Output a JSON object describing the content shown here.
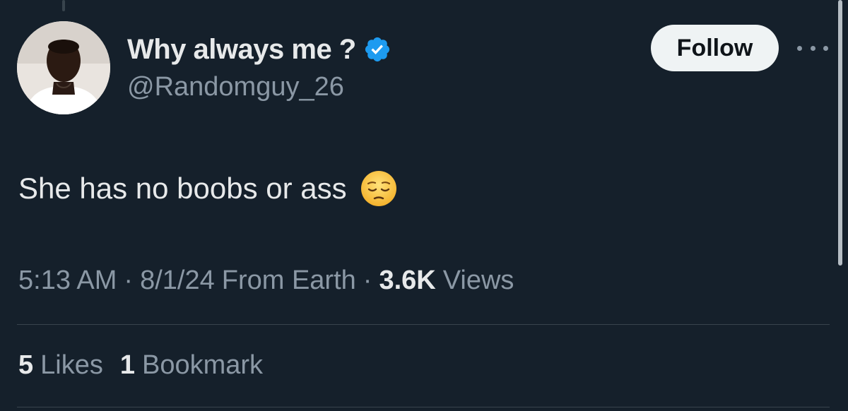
{
  "tweet": {
    "author": {
      "display_name": "Why always me ?",
      "handle": "@Randomguy_26",
      "verified": true,
      "avatar_icon": "profile-photo"
    },
    "follow_label": "Follow",
    "more_icon": "more-horizontal-icon",
    "text": "She has no boobs or ass",
    "emoji_icon": "pensive-face-emoji",
    "meta": {
      "time": "5:13 AM",
      "date": "8/1/24",
      "source": "From Earth",
      "views_count": "3.6K",
      "views_label": "Views"
    },
    "stats": {
      "likes_count": "5",
      "likes_label": "Likes",
      "bookmarks_count": "1",
      "bookmarks_label": "Bookmark"
    }
  },
  "colors": {
    "background": "#15202b",
    "text_primary": "#e7e9ea",
    "text_secondary": "#8b98a5",
    "verified_blue": "#1d9bf0",
    "follow_button_bg": "#eff3f4",
    "divider": "#38444d"
  }
}
